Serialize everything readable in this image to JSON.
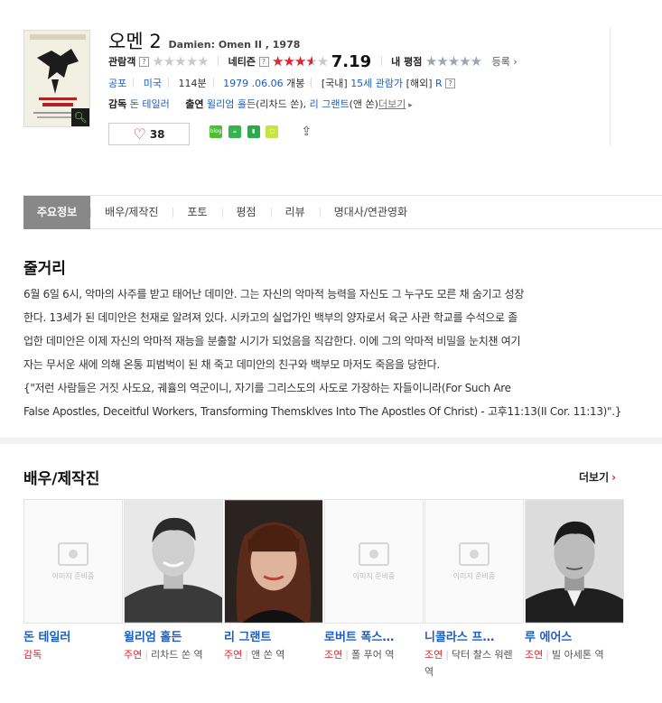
{
  "movie": {
    "title": "오멘 2",
    "subtitle": "Damien: Omen II , 1978",
    "poster_text": "DAMIEN\nOMEN II",
    "audience_label": "관람객",
    "netizen_label": "네티즌",
    "netizen_score": "7.19",
    "netizen_rating_fraction": 0.72,
    "my_label": "내 평점",
    "register_label": "등록",
    "genre": "공포",
    "country": "미국",
    "runtime": "114분",
    "release_date": "1979 .06.06",
    "release_suffix": "개봉",
    "domestic_label": "[국내]",
    "domestic_rating": "15세 관람가",
    "overseas_label": "[해외]",
    "overseas_rating": "R",
    "director_label": "감독",
    "director": "돈 테일러",
    "cast_label": "출연",
    "actor1": "윌리엄 홀든",
    "actor1_role": "(리차드 쏜)",
    "actor2": "리 그랜트",
    "actor2_role": "(앤 쏜)",
    "more_link": "더보기",
    "likes": "38"
  },
  "tabs": [
    "주요정보",
    "배우/제작진",
    "포토",
    "평점",
    "리뷰",
    "명대사/연관영화"
  ],
  "synopsis": {
    "title": "줄거리",
    "lines": [
      "6월 6일 6시, 악마의 사주를 받고 태어난 데미안. 그는 자신의 악마적 능력을 자신도 그 누구도 모른 채 숨기고 성장",
      "한다. 13세가 된 데미안은 천재로 알려져 있다. 시카고의 실업가인 백부의 양자로서 육군 사관 학교를 수석으로 졸",
      "업한 데미안은 이제 자신의 악마적 재능을 분출할 시기가 되었음을 직감한다. 이에 그의 악마적 비밀을 눈치챈 여기",
      "자는 무서운 새에 의해 온통 피범벅이 된 채 죽고 데미안의 친구와 백부모 마저도 죽음을 당한다.",
      "  {\"저런 사람들은 거짓 사도요, 궤휼의 역군이니, 자기를 그리스도의 사도로 가장하는 자들이니라(For Such Are",
      "False Apostles, Deceitful Workers, Transforming Themsklves Into The Apostles Of Christ) - 고후11:13(II Cor. 11:13)\".}"
    ]
  },
  "cast_section": {
    "title": "배우/제작진",
    "more": "더보기",
    "placeholder_text": "이미지 준비중",
    "people": [
      {
        "name": "돈 테일러",
        "kind": "감독",
        "role": ""
      },
      {
        "name": "윌리엄 홀든",
        "kind": "주연",
        "role": "리차드 쏜 역"
      },
      {
        "name": "리 그랜트",
        "kind": "주연",
        "role": "앤 쏜 역"
      },
      {
        "name": "로버트 폭스…",
        "kind": "조연",
        "role": "폴 푸어 역"
      },
      {
        "name": "니콜라스 프…",
        "kind": "조연",
        "role": "닥터 찰스 워렌 역"
      },
      {
        "name": "루 에어스",
        "kind": "조연",
        "role": "빌 아세톤 역"
      }
    ]
  },
  "colors": {
    "accent": "#e0242f",
    "link": "#1a5ec3",
    "tab_active": "#888888"
  }
}
